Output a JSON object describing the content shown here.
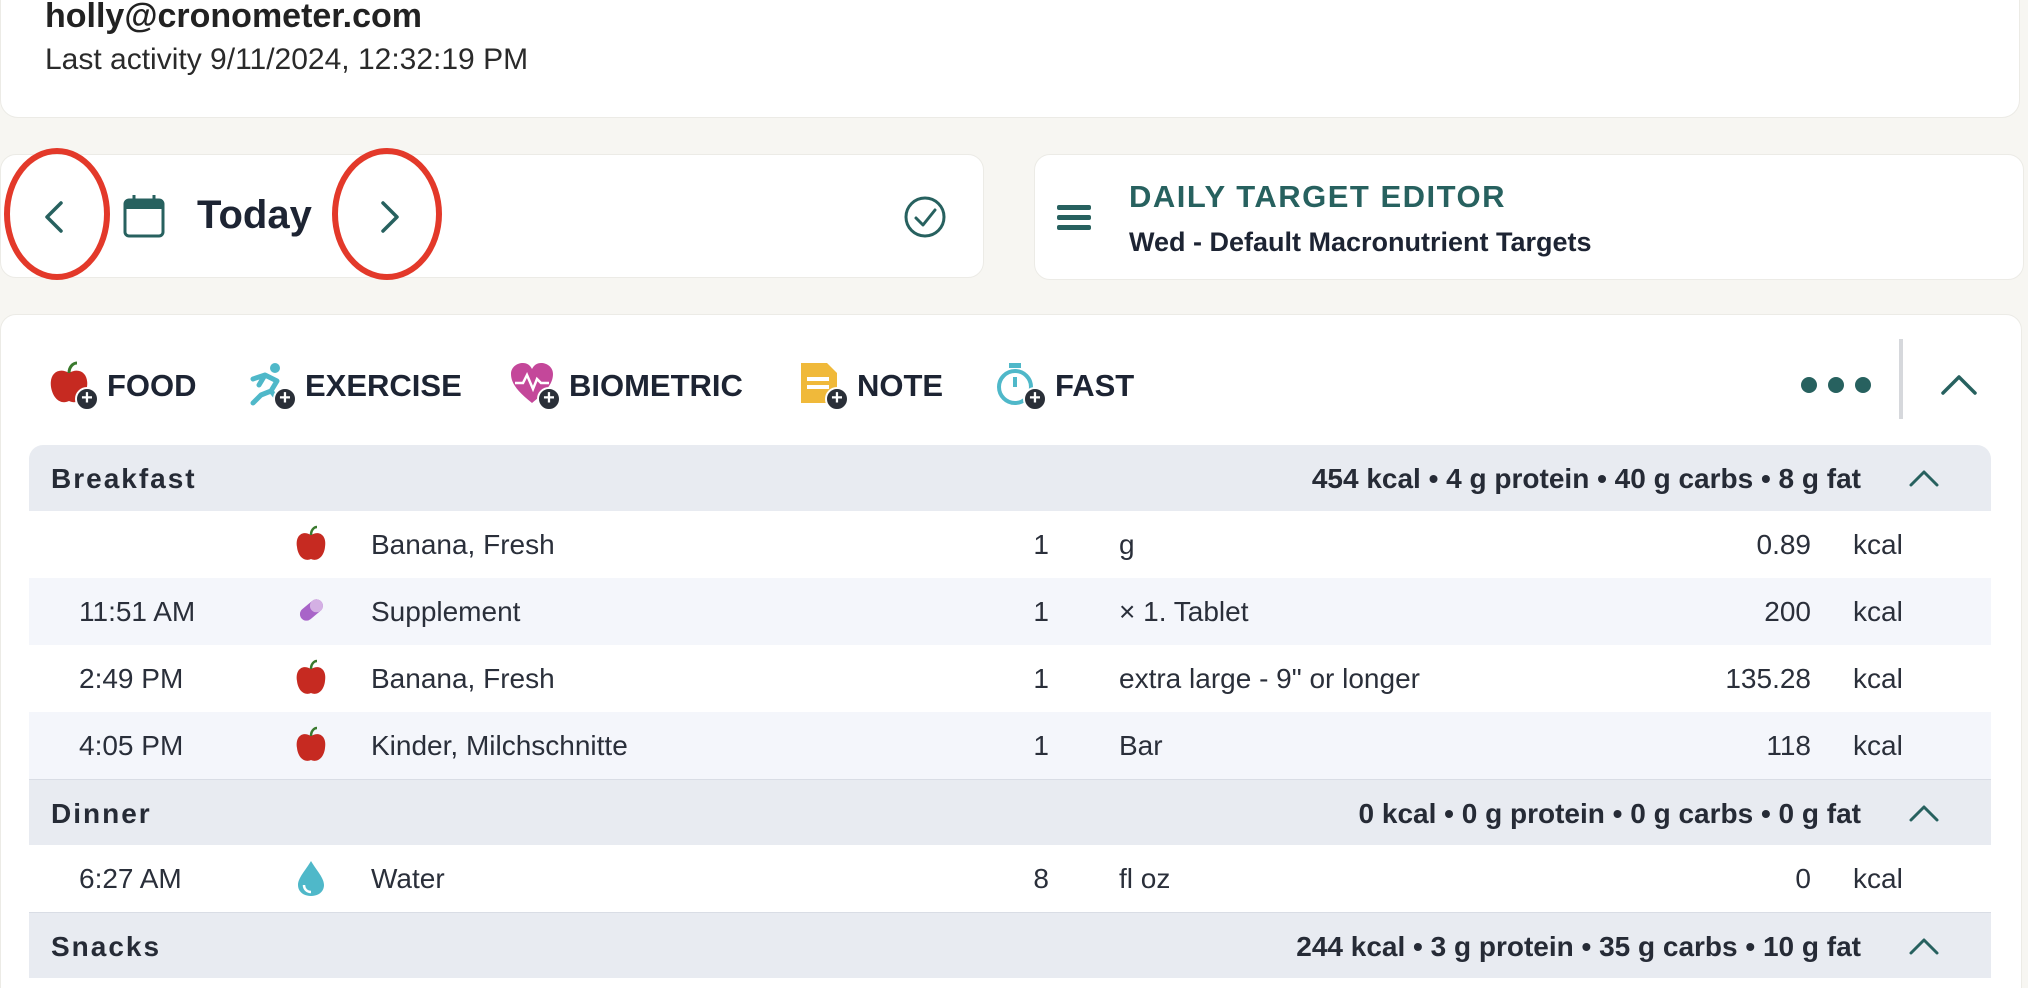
{
  "user": {
    "email": "holly@cronometer.com",
    "last_activity": "Last activity 9/11/2024, 12:32:19 PM"
  },
  "date_nav": {
    "label": "Today",
    "prev_icon": "chevron-left-icon",
    "next_icon": "chevron-right-icon",
    "calendar_icon": "calendar-icon",
    "complete_icon": "check-circle-icon"
  },
  "target_editor": {
    "title": "DAILY TARGET EDITOR",
    "subtitle": "Wed - Default Macronutrient Targets"
  },
  "add_buttons": [
    {
      "label": "FOOD",
      "icon": "apple-add-icon"
    },
    {
      "label": "EXERCISE",
      "icon": "runner-add-icon"
    },
    {
      "label": "BIOMETRIC",
      "icon": "heart-add-icon"
    },
    {
      "label": "NOTE",
      "icon": "note-add-icon"
    },
    {
      "label": "FAST",
      "icon": "stopwatch-add-icon"
    }
  ],
  "groups": [
    {
      "name": "Breakfast",
      "summary": "454 kcal • 4 g protein • 40 g carbs • 8 g fat",
      "entries": [
        {
          "time": "",
          "icon": "food",
          "name": "Banana, Fresh",
          "qty": "1",
          "unit": "g",
          "value": "0.89",
          "kcal": "kcal"
        },
        {
          "time": "11:51 AM",
          "icon": "supplement",
          "name": "Supplement",
          "qty": "1",
          "unit": "× 1. Tablet",
          "value": "200",
          "kcal": "kcal"
        },
        {
          "time": "2:49 PM",
          "icon": "food",
          "name": "Banana, Fresh",
          "qty": "1",
          "unit": "extra large - 9\" or longer",
          "value": "135.28",
          "kcal": "kcal"
        },
        {
          "time": "4:05 PM",
          "icon": "food",
          "name": "Kinder, Milchschnitte",
          "qty": "1",
          "unit": "Bar",
          "value": "118",
          "kcal": "kcal"
        }
      ]
    },
    {
      "name": "Dinner",
      "summary": "0 kcal • 0 g protein • 0 g carbs • 0 g fat",
      "entries": [
        {
          "time": "6:27 AM",
          "icon": "water",
          "name": "Water",
          "qty": "8",
          "unit": "fl oz",
          "value": "0",
          "kcal": "kcal"
        }
      ]
    },
    {
      "name": "Snacks",
      "summary": "244 kcal • 3 g protein • 35 g carbs • 10 g fat",
      "entries": []
    }
  ],
  "colors": {
    "accent": "#27615f",
    "highlight_ring": "#e3392a",
    "food_icon": "#c62a21",
    "supplement_icon": "#a864c8",
    "water_icon": "#4fb8c9"
  }
}
